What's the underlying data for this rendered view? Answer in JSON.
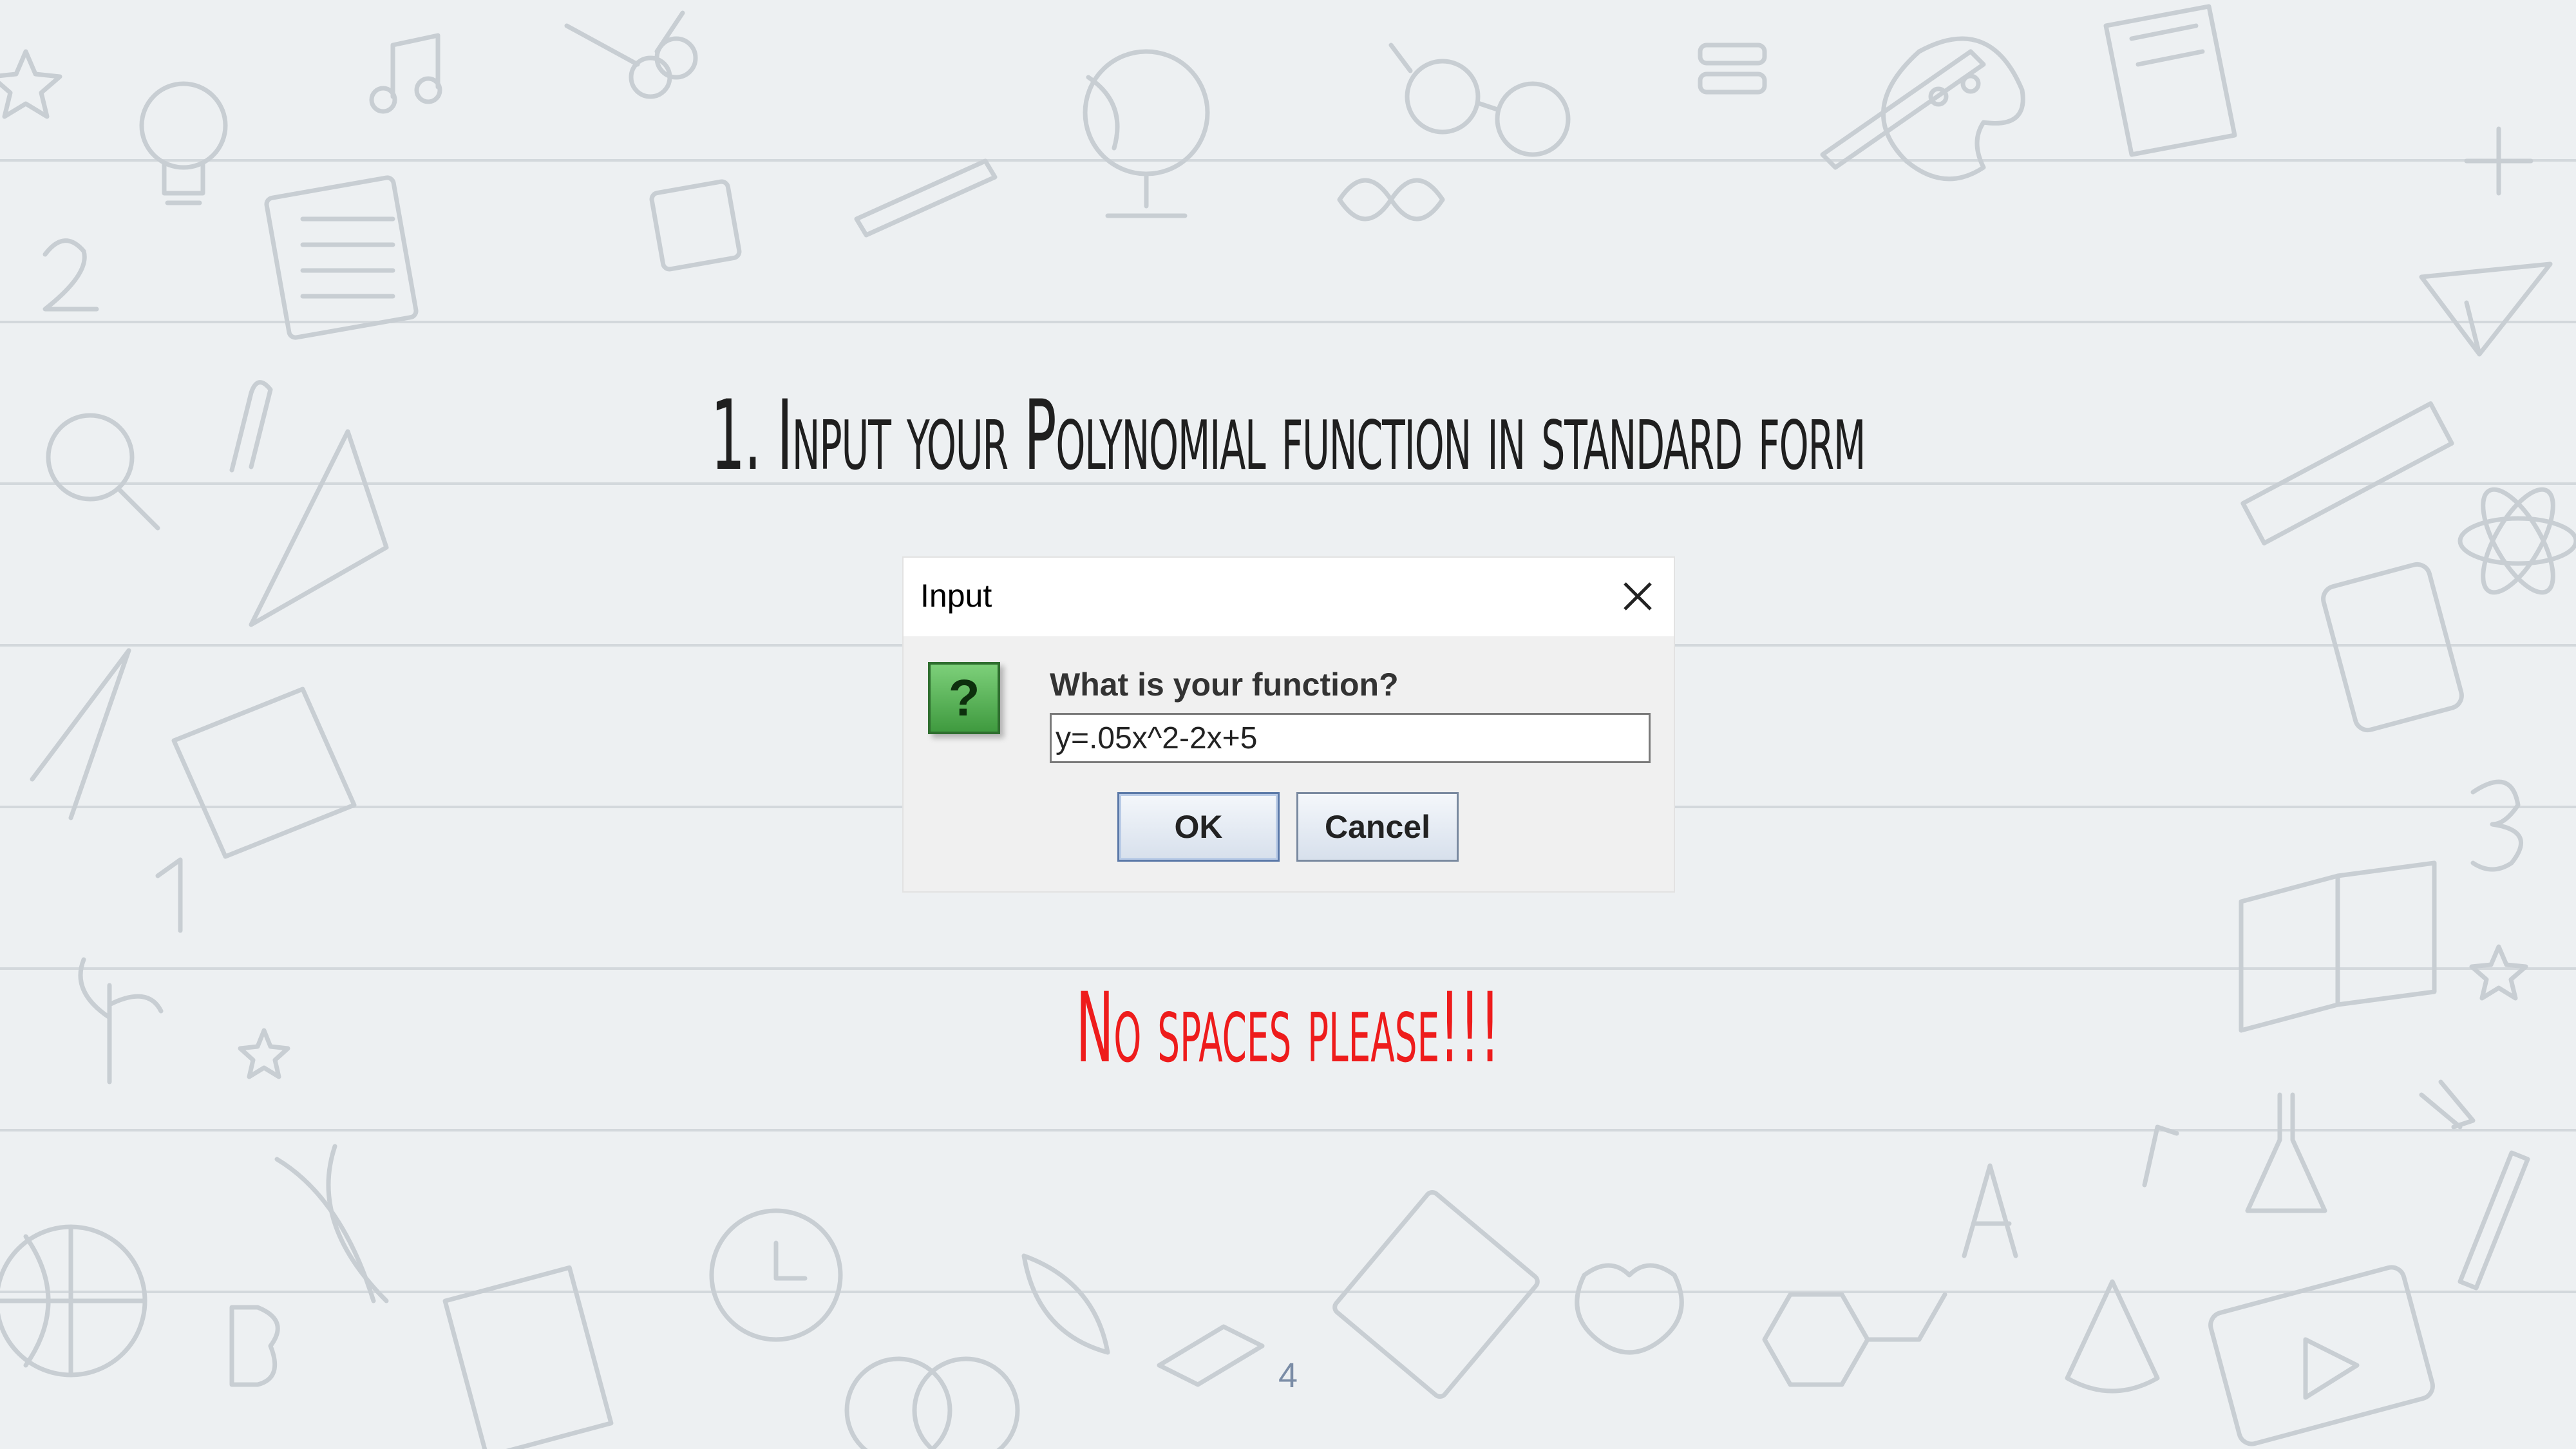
{
  "slide": {
    "title": "1. Input your Polynomial function in standard form",
    "warning": "No spaces please!!!",
    "page_number": "4"
  },
  "dialog": {
    "title": "Input",
    "close_icon": "close-icon",
    "question_icon": "question-icon",
    "question_glyph": "?",
    "prompt": "What is your function?",
    "input_value": "y=.05x^2-2x+5",
    "ok_label": "OK",
    "cancel_label": "Cancel"
  },
  "colors": {
    "title_text": "#1f1f1f",
    "warning_text": "#ee1c1c",
    "page_number": "#7a8ca6",
    "icon_green": "#3f9a3f"
  }
}
